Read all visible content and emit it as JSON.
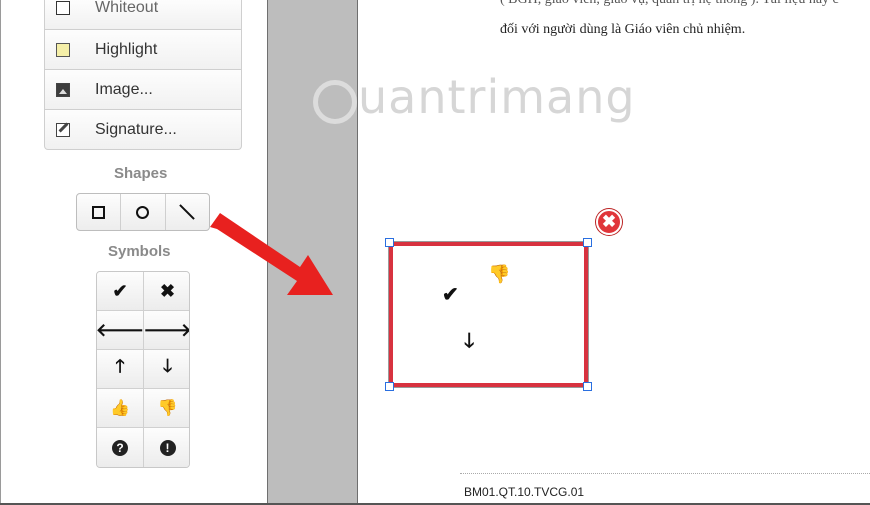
{
  "tools": [
    {
      "label": "Whiteout",
      "icon": "whiteout-icon"
    },
    {
      "label": "Highlight",
      "icon": "highlight-icon"
    },
    {
      "label": "Image...",
      "icon": "image-icon"
    },
    {
      "label": "Signature...",
      "icon": "signature-icon"
    }
  ],
  "shapes": {
    "title": "Shapes",
    "items": [
      "rectangle-icon",
      "circle-icon",
      "line-icon"
    ]
  },
  "symbols": {
    "title": "Symbols",
    "items": [
      {
        "glyph": "✔",
        "icon": "check-icon"
      },
      {
        "glyph": "✖",
        "icon": "cross-icon"
      },
      {
        "glyph": "🡐",
        "icon": "arrow-left-icon"
      },
      {
        "glyph": "🡒",
        "icon": "arrow-right-icon"
      },
      {
        "glyph": "🡑",
        "icon": "arrow-up-icon"
      },
      {
        "glyph": "🡓",
        "icon": "arrow-down-icon"
      },
      {
        "glyph": "👍",
        "icon": "thumbs-up-icon"
      },
      {
        "glyph": "👎",
        "icon": "thumbs-down-icon"
      },
      {
        "glyph": "?",
        "icon": "question-icon"
      },
      {
        "glyph": "!",
        "icon": "exclamation-icon"
      }
    ]
  },
  "document": {
    "line1": "( BGH, giáo viên, giáo vụ, quản trị hệ thống ). Tài liệu này c",
    "line2": "đối với người dùng là Giáo viên chủ nhiệm.",
    "watermark": "uantrimang",
    "footer_code": "BM01.QT.10.TVCG.01"
  },
  "annotation": {
    "close_glyph": "✖",
    "marks": [
      "✔",
      "👎",
      "🡓"
    ]
  },
  "colors": {
    "annotation_border": "#d8323f",
    "handle": "#2a6fe0",
    "arrow": "#e8211f"
  }
}
